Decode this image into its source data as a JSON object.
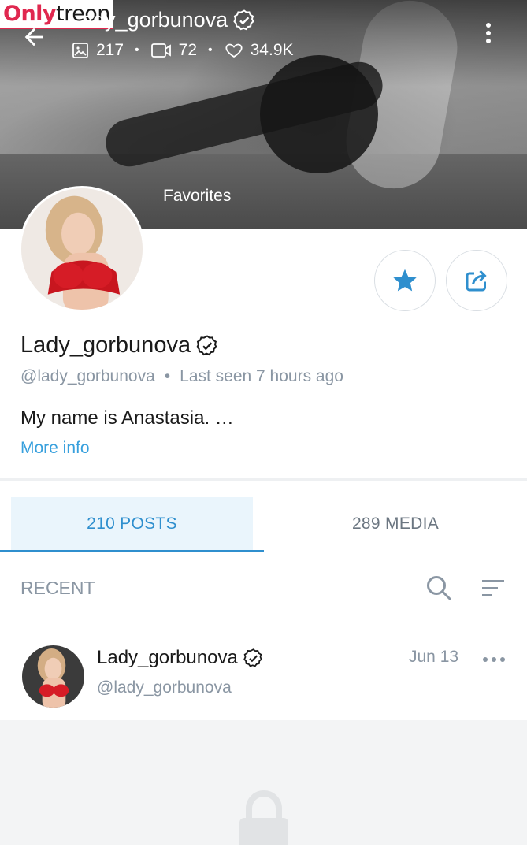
{
  "watermark": {
    "part1": "Only",
    "part2": "treon"
  },
  "header": {
    "title": "Lady_gorbunova",
    "stats": {
      "photos": "217",
      "videos": "72",
      "likes": "34.9K"
    },
    "cover_label": "Favorites"
  },
  "profile": {
    "name": "Lady_gorbunova",
    "handle": "@lady_gorbunova",
    "separator": "•",
    "last_seen": "Last seen 7 hours ago",
    "bio": "My name is Anastasia. …",
    "more_info": "More info"
  },
  "tabs": [
    {
      "label": "210 POSTS",
      "active": true
    },
    {
      "label": "289 MEDIA",
      "active": false
    }
  ],
  "feed": {
    "section_label": "RECENT",
    "post": {
      "name": "Lady_gorbunova",
      "handle": "@lady_gorbunova",
      "date": "Jun 13"
    }
  },
  "colors": {
    "accent": "#2f8fce",
    "link": "#38a0dd",
    "muted": "#8a96a3",
    "watermark_red": "#e0284f"
  },
  "icons": [
    "back-arrow-icon",
    "photo-icon",
    "video-icon",
    "heart-icon",
    "more-vert-icon",
    "verified-icon",
    "star-icon",
    "share-icon",
    "search-icon",
    "sort-icon",
    "more-horiz-icon",
    "lock-icon"
  ]
}
